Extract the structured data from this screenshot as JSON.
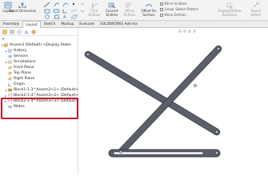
{
  "ribbon": {
    "layout_label": "Layout",
    "smart_dimension_label": "Smart Dimension",
    "convert_entities_label": "Convert Entities",
    "offset_entities_label": "Offset Entities",
    "offset_on_surface_label": "Offset On Surface",
    "trim_entities_label": "Trim Entities",
    "mirror_entities_label": "Mirror Entities",
    "linear_sketch_pattern_label": "Linear Sketch Pattern",
    "move_entities_label": "Move Entities",
    "display_delete_relations_label": "Display/Delete Relations",
    "repair_sketch_label": "Repair Sketch"
  },
  "tabs": [
    "Assembly",
    "Layout",
    "Sketch",
    "Markup",
    "Evaluate",
    "SOLIDWORKS Add-Ins"
  ],
  "active_tab": "Layout",
  "tree": {
    "root": "Assem3 (Default) <Display State-",
    "items": [
      {
        "label": "History",
        "icon": "history-icon",
        "expand": "▸"
      },
      {
        "label": "Sensors",
        "icon": "sensors-icon",
        "expand": ""
      },
      {
        "label": "Annotations",
        "icon": "annotations-icon",
        "expand": "▸"
      },
      {
        "label": "Front Plane",
        "icon": "plane-icon",
        "expand": ""
      },
      {
        "label": "Top Plane",
        "icon": "plane-icon",
        "expand": ""
      },
      {
        "label": "Right Plane",
        "icon": "plane-icon",
        "expand": ""
      },
      {
        "label": "Origin",
        "icon": "origin-icon",
        "expand": ""
      }
    ],
    "blocks": [
      {
        "label": "Block1-1-3^Assem3<1> (Default>",
        "expand": "▸"
      },
      {
        "label": "(-) Block2-1-4^Assem3<2> (Default>",
        "expand": "▸"
      },
      {
        "label": "(-) Block2-1-4^Assem3<3> (Default>",
        "expand": "▸"
      }
    ],
    "mates": "Mates"
  },
  "colors": {
    "highlight": "#c8102e",
    "link_fill": "#5a5f6a",
    "link_stroke": "#3a3d44",
    "plane_icon": "#f0c98a",
    "block_icon": "#e0a43a"
  }
}
